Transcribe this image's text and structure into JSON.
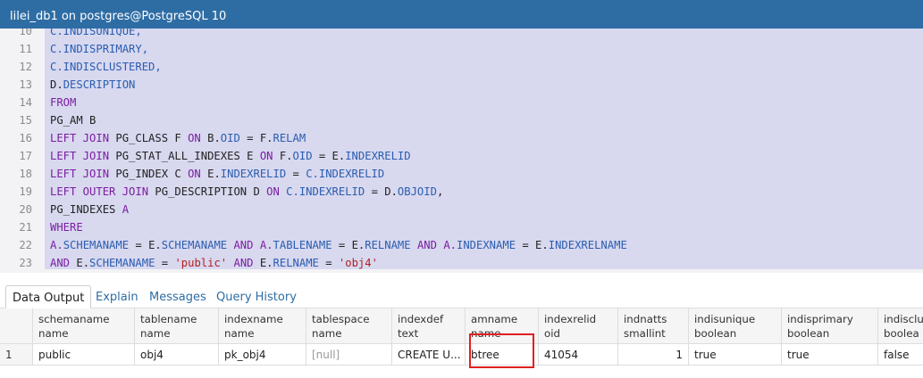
{
  "window": {
    "title": "lilei_db1 on postgres@PostgreSQL 10"
  },
  "editor": {
    "lines": [
      {
        "num": "10",
        "tokens": [
          {
            "t": "C.INDISUNIQUE,",
            "c": "kb"
          }
        ]
      },
      {
        "num": "11",
        "tokens": [
          {
            "t": "C.INDISPRIMARY,",
            "c": "kb"
          }
        ]
      },
      {
        "num": "12",
        "tokens": [
          {
            "t": "C.INDISCLUSTERED,",
            "c": "kb"
          }
        ]
      },
      {
        "num": "13",
        "tokens": [
          {
            "t": "D.",
            "c": ""
          },
          {
            "t": "DESCRIPTION",
            "c": "kb"
          }
        ]
      },
      {
        "num": "14",
        "tokens": [
          {
            "t": "FROM",
            "c": "kw"
          }
        ]
      },
      {
        "num": "15",
        "tokens": [
          {
            "t": "PG_AM B",
            "c": ""
          }
        ]
      },
      {
        "num": "16",
        "tokens": [
          {
            "t": "LEFT JOIN ",
            "c": "kw"
          },
          {
            "t": "PG_CLASS F ",
            "c": ""
          },
          {
            "t": "ON ",
            "c": "kw"
          },
          {
            "t": "B.",
            "c": ""
          },
          {
            "t": "OID",
            "c": "kb"
          },
          {
            "t": " = F.",
            "c": ""
          },
          {
            "t": "RELAM",
            "c": "kb"
          }
        ]
      },
      {
        "num": "17",
        "tokens": [
          {
            "t": "LEFT JOIN ",
            "c": "kw"
          },
          {
            "t": "PG_STAT_ALL_INDEXES E ",
            "c": ""
          },
          {
            "t": "ON ",
            "c": "kw"
          },
          {
            "t": "F.",
            "c": ""
          },
          {
            "t": "OID",
            "c": "kb"
          },
          {
            "t": " = E.",
            "c": ""
          },
          {
            "t": "INDEXRELID",
            "c": "kb"
          }
        ]
      },
      {
        "num": "18",
        "tokens": [
          {
            "t": "LEFT JOIN ",
            "c": "kw"
          },
          {
            "t": "PG_INDEX C ",
            "c": ""
          },
          {
            "t": "ON ",
            "c": "kw"
          },
          {
            "t": "E.",
            "c": ""
          },
          {
            "t": "INDEXRELID",
            "c": "kb"
          },
          {
            "t": " = ",
            "c": ""
          },
          {
            "t": "C.INDEXRELID",
            "c": "kb"
          }
        ]
      },
      {
        "num": "19",
        "tokens": [
          {
            "t": "LEFT OUTER JOIN ",
            "c": "kw"
          },
          {
            "t": "PG_DESCRIPTION D ",
            "c": ""
          },
          {
            "t": "ON ",
            "c": "kw"
          },
          {
            "t": "C.INDEXRELID",
            "c": "kb"
          },
          {
            "t": " = D.",
            "c": ""
          },
          {
            "t": "OBJOID",
            "c": "kb"
          },
          {
            "t": ",",
            "c": ""
          }
        ]
      },
      {
        "num": "20",
        "tokens": [
          {
            "t": "PG_INDEXES ",
            "c": ""
          },
          {
            "t": "A",
            "c": "kw"
          }
        ]
      },
      {
        "num": "21",
        "tokens": [
          {
            "t": "WHERE",
            "c": "kw"
          }
        ]
      },
      {
        "num": "22",
        "tokens": [
          {
            "t": "A.",
            "c": "kw"
          },
          {
            "t": "SCHEMANAME",
            "c": "kb"
          },
          {
            "t": " = E.",
            "c": ""
          },
          {
            "t": "SCHEMANAME ",
            "c": "kb"
          },
          {
            "t": "AND ",
            "c": "kw"
          },
          {
            "t": "A.",
            "c": "kw"
          },
          {
            "t": "TABLENAME",
            "c": "kb"
          },
          {
            "t": " = E.",
            "c": ""
          },
          {
            "t": "RELNAME ",
            "c": "kb"
          },
          {
            "t": "AND ",
            "c": "kw"
          },
          {
            "t": "A.",
            "c": "kw"
          },
          {
            "t": "INDEXNAME",
            "c": "kb"
          },
          {
            "t": " = E.",
            "c": ""
          },
          {
            "t": "INDEXRELNAME",
            "c": "kb"
          }
        ]
      },
      {
        "num": "23",
        "tokens": [
          {
            "t": "AND ",
            "c": "kw"
          },
          {
            "t": "E.",
            "c": ""
          },
          {
            "t": "SCHEMANAME",
            "c": "kb"
          },
          {
            "t": " = ",
            "c": ""
          },
          {
            "t": "'public'",
            "c": "str"
          },
          {
            "t": " ",
            "c": ""
          },
          {
            "t": "AND ",
            "c": "kw"
          },
          {
            "t": "E.",
            "c": ""
          },
          {
            "t": "RELNAME",
            "c": "kb"
          },
          {
            "t": " = ",
            "c": ""
          },
          {
            "t": "'obj4'",
            "c": "str"
          }
        ]
      }
    ]
  },
  "tabs": [
    {
      "label": "Data Output",
      "active": true
    },
    {
      "label": "Explain",
      "active": false
    },
    {
      "label": "Messages",
      "active": false
    },
    {
      "label": "Query History",
      "active": false
    }
  ],
  "results": {
    "columns": [
      {
        "name": "schemaname",
        "type": "name"
      },
      {
        "name": "tablename",
        "type": "name"
      },
      {
        "name": "indexname",
        "type": "name"
      },
      {
        "name": "tablespace",
        "type": "name"
      },
      {
        "name": "indexdef",
        "type": "text"
      },
      {
        "name": "amname",
        "type": "name"
      },
      {
        "name": "indexrelid",
        "type": "oid"
      },
      {
        "name": "indnatts",
        "type": "smallint"
      },
      {
        "name": "indisunique",
        "type": "boolean"
      },
      {
        "name": "indisprimary",
        "type": "boolean"
      },
      {
        "name": "indisclu",
        "type": "boolea"
      }
    ],
    "rows": [
      {
        "num": "1",
        "cells": [
          "public",
          "obj4",
          "pk_obj4",
          "[null]",
          "CREATE U...",
          "btree",
          "41054",
          "1",
          "true",
          "true",
          "false"
        ]
      }
    ]
  }
}
